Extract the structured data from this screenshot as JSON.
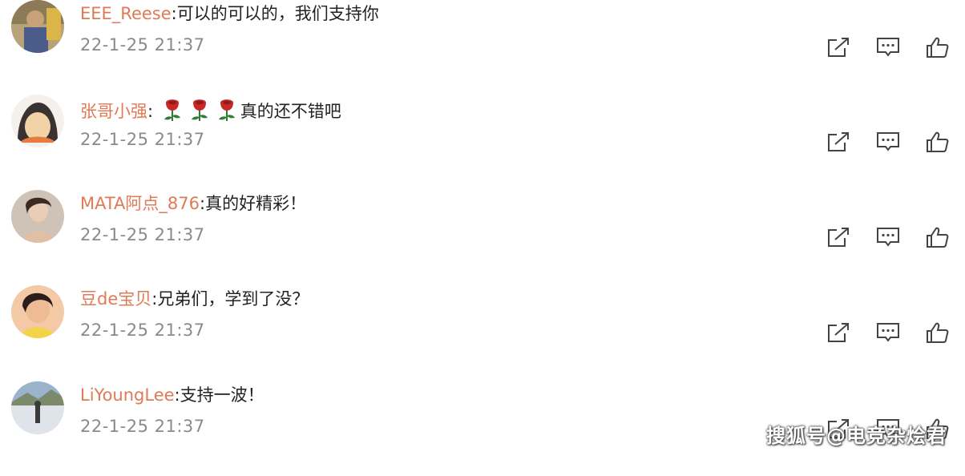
{
  "comments": [
    {
      "username": "EEE_Reese",
      "separator": ":",
      "text": "可以的可以的，我们支持你",
      "time": "22-1-25 21:37",
      "rose_count": 0
    },
    {
      "username": "张哥小强",
      "separator": ":",
      "text": "真的还不错吧",
      "time": "22-1-25 21:37",
      "rose_count": 3
    },
    {
      "username": "MATA阿点_876",
      "separator": ":",
      "text": "真的好精彩！",
      "time": "22-1-25 21:37",
      "rose_count": 0
    },
    {
      "username": "豆de宝贝",
      "separator": ":",
      "text": "兄弟们，学到了没？",
      "time": "22-1-25 21:37",
      "rose_count": 0
    },
    {
      "username": "LiYoungLee",
      "separator": ":",
      "text": "支持一波！",
      "time": "22-1-25 21:37",
      "rose_count": 0
    }
  ],
  "action_icons": [
    "share-icon",
    "comment-icon",
    "like-icon"
  ],
  "watermark": "搜狐号@电竞杂烩君",
  "colors": {
    "username": "#e07a56",
    "time": "#8a8a8a",
    "text": "#222222",
    "icon": "#444444"
  }
}
